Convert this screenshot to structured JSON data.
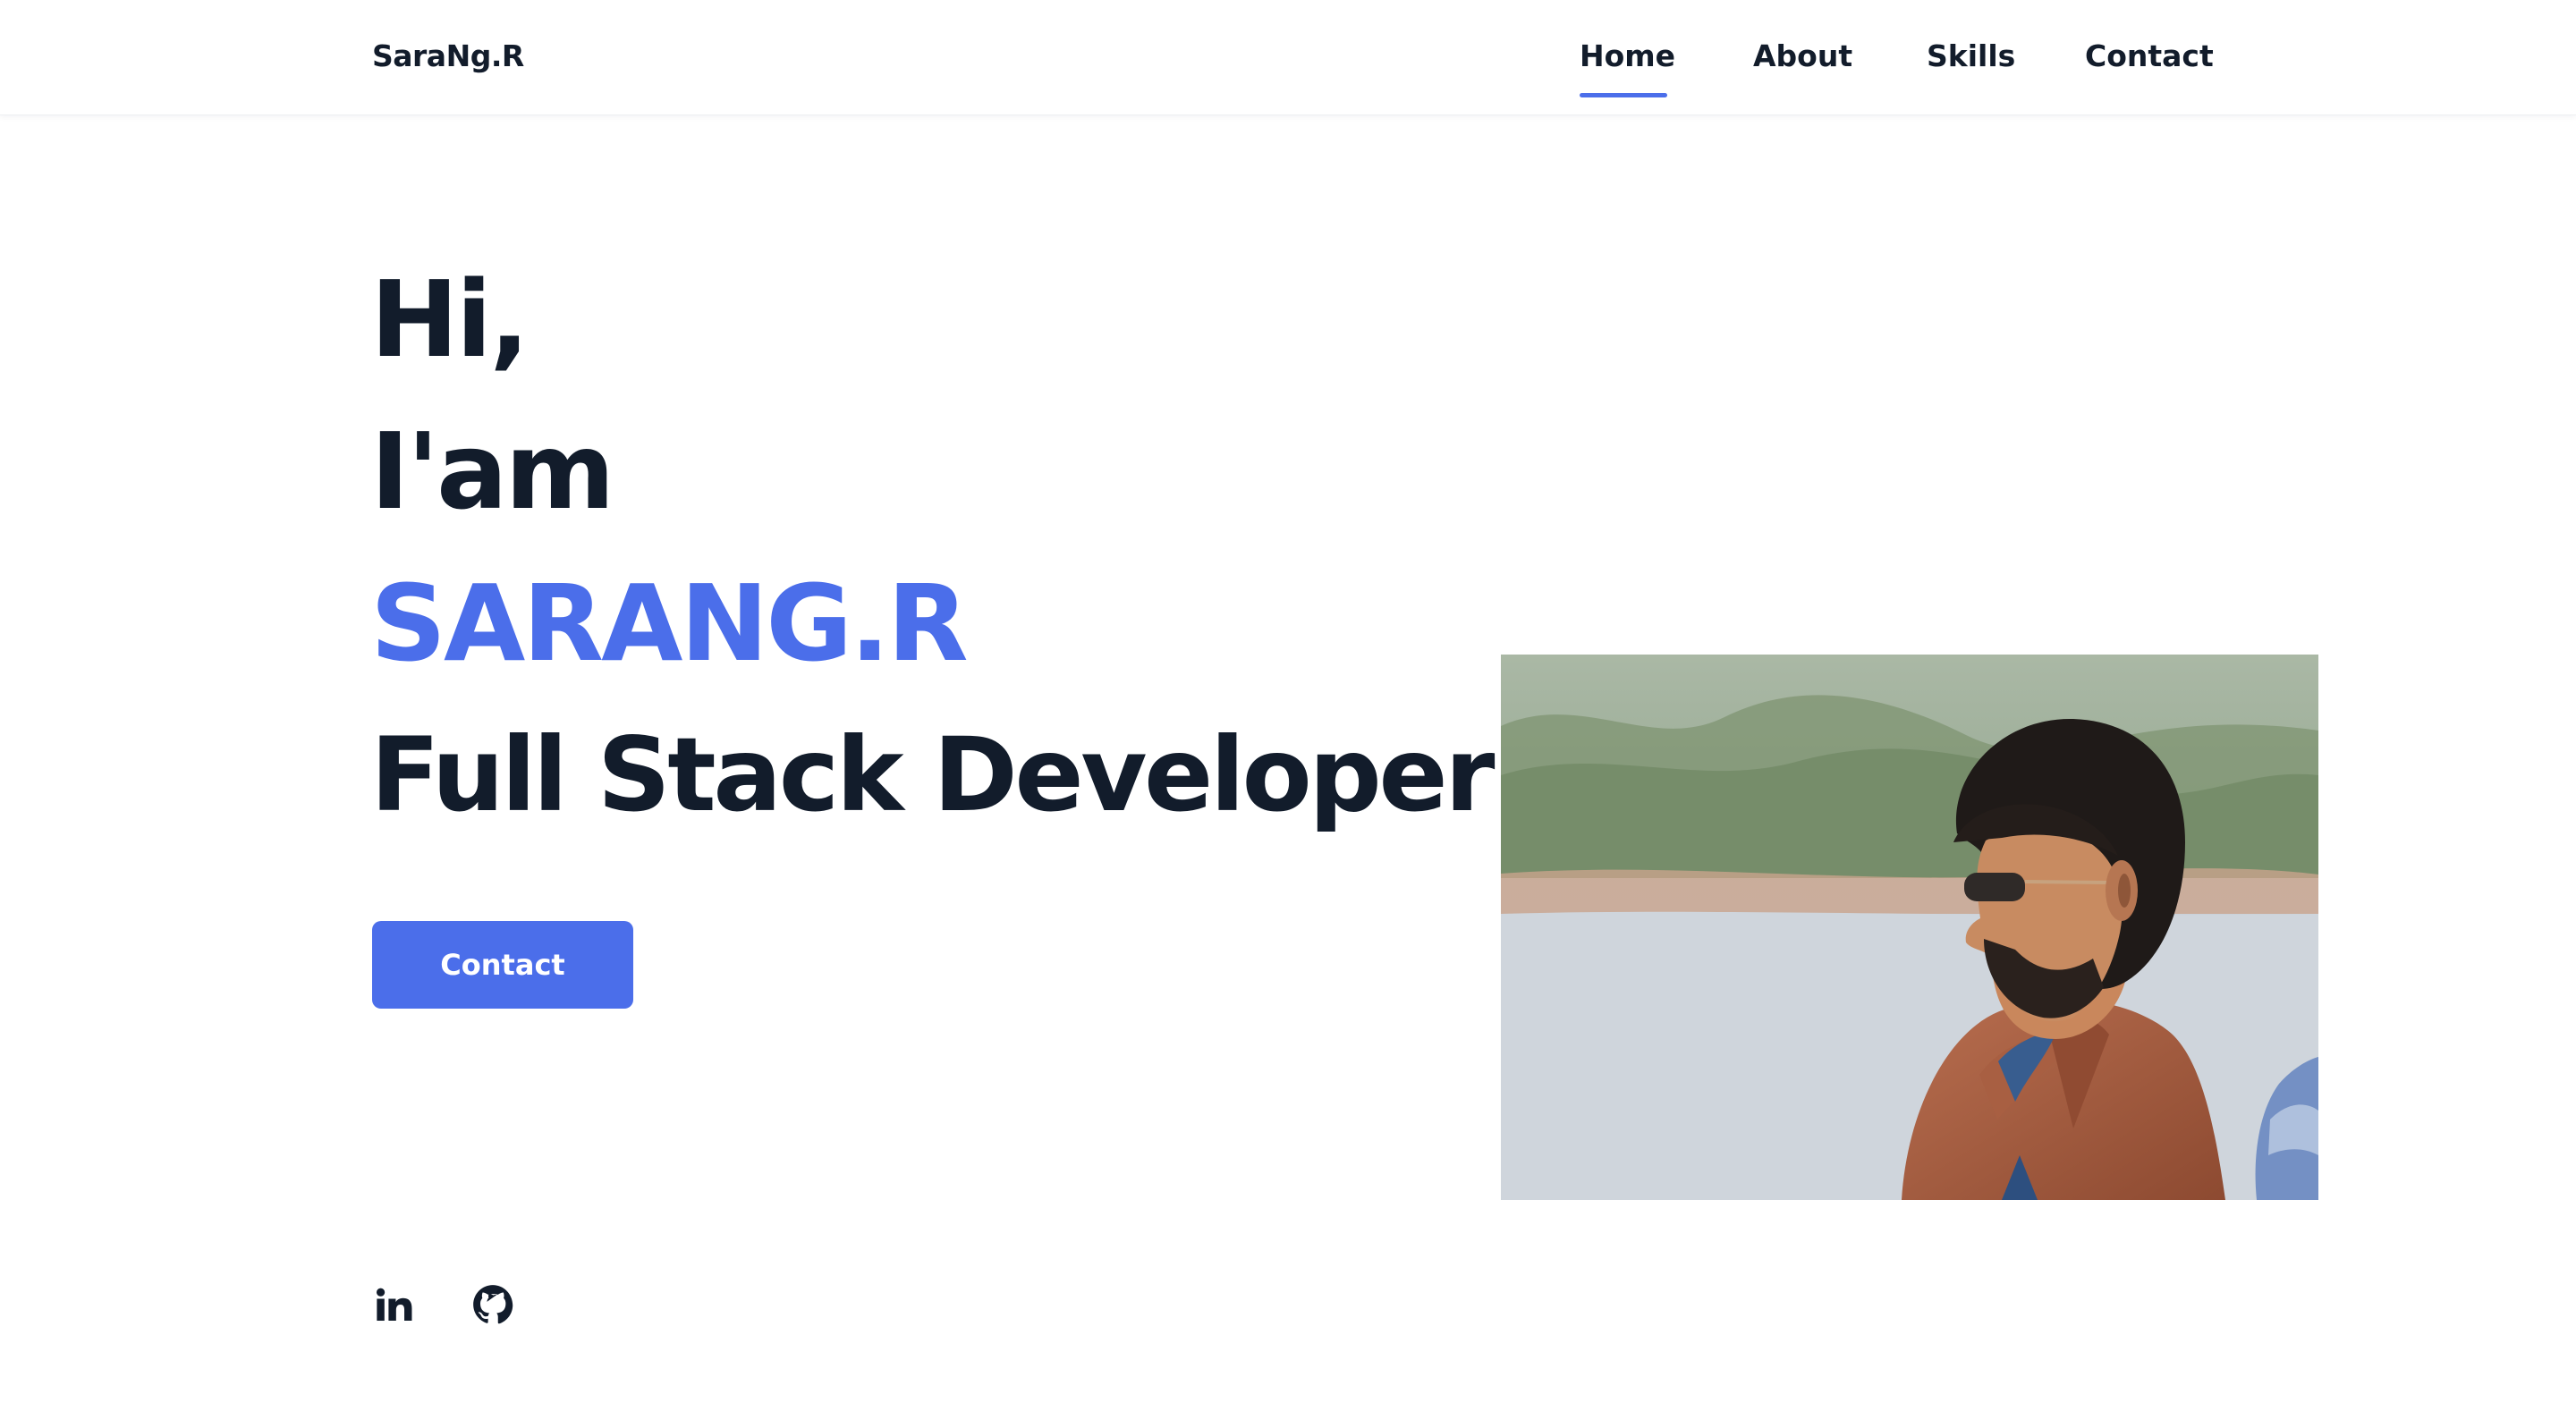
{
  "header": {
    "logo": "SaraNg.R",
    "nav": [
      {
        "label": "Home",
        "active": true
      },
      {
        "label": "About",
        "active": false
      },
      {
        "label": "Skills",
        "active": false
      },
      {
        "label": "Contact",
        "active": false
      }
    ]
  },
  "hero": {
    "greeting": "Hi,",
    "intro": "I'am",
    "name": "SARANG.R",
    "role": "Full Stack Developer",
    "button_label": "Contact"
  },
  "social": [
    {
      "icon": "linkedin-icon"
    },
    {
      "icon": "github-icon"
    }
  ],
  "colors": {
    "accent": "#4b6eea",
    "text": "#121c2b",
    "background": "#ffffff"
  }
}
